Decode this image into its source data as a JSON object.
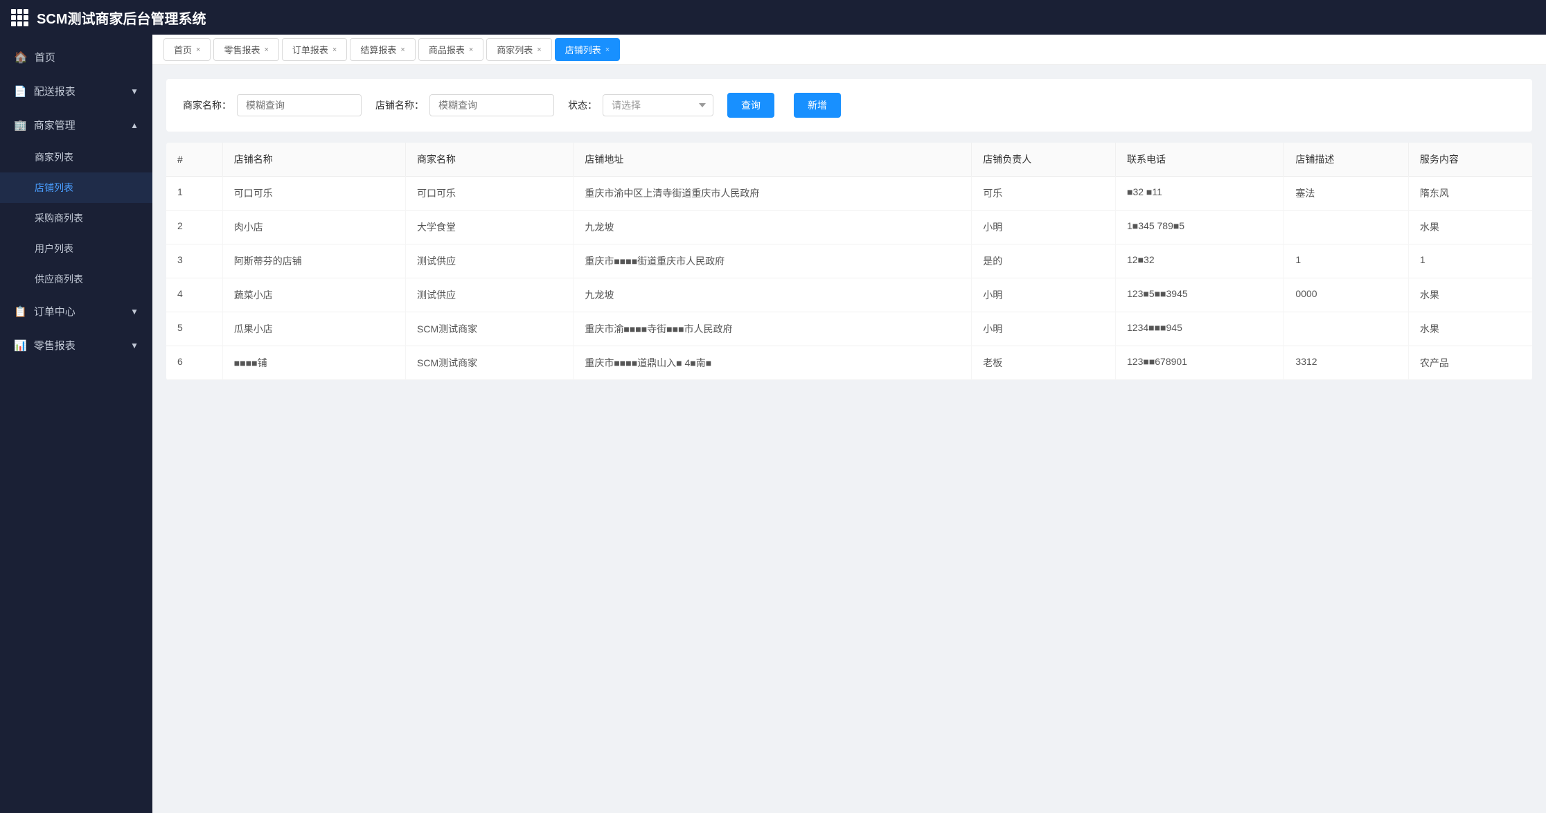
{
  "app": {
    "title": "SCM测试商家后台管理系统"
  },
  "header": {
    "title": "SCM测试商家后台管理系统"
  },
  "sidebar": {
    "items": [
      {
        "id": "home",
        "label": "首页",
        "icon": "🏠",
        "type": "item",
        "active": false
      },
      {
        "id": "delivery-report",
        "label": "配送报表",
        "icon": "📄",
        "type": "group",
        "expanded": false
      },
      {
        "id": "merchant-mgmt",
        "label": "商家管理",
        "icon": "🏢",
        "type": "group",
        "expanded": true
      },
      {
        "id": "merchant-list",
        "label": "商家列表",
        "type": "sub",
        "active": false
      },
      {
        "id": "store-list",
        "label": "店铺列表",
        "type": "sub",
        "active": true
      },
      {
        "id": "purchase-list",
        "label": "采购商列表",
        "type": "sub",
        "active": false
      },
      {
        "id": "user-list",
        "label": "用户列表",
        "type": "sub",
        "active": false
      },
      {
        "id": "supplier-list",
        "label": "供应商列表",
        "type": "sub",
        "active": false
      },
      {
        "id": "order-center",
        "label": "订单中心",
        "icon": "📋",
        "type": "group",
        "expanded": false
      },
      {
        "id": "retail-report",
        "label": "零售报表",
        "icon": "📊",
        "type": "group",
        "expanded": false
      }
    ]
  },
  "tabs": [
    {
      "label": "首页",
      "closable": true,
      "active": false
    },
    {
      "label": "零售报表",
      "closable": true,
      "active": false
    },
    {
      "label": "订单报表",
      "closable": true,
      "active": false
    },
    {
      "label": "结算报表",
      "closable": true,
      "active": false
    },
    {
      "label": "商品报表",
      "closable": true,
      "active": false
    },
    {
      "label": "商家列表",
      "closable": true,
      "active": false
    },
    {
      "label": "店铺列表",
      "closable": true,
      "active": true
    }
  ],
  "search": {
    "merchant_name_label": "商家名称：",
    "merchant_name_placeholder": "模糊查询",
    "store_name_label": "店铺名称：",
    "store_name_placeholder": "模糊查询",
    "status_label": "状态：",
    "status_placeholder": "请选择",
    "query_btn": "查询",
    "add_btn": "新增"
  },
  "table": {
    "columns": [
      "#",
      "店铺名称",
      "商家名称",
      "店铺地址",
      "店铺负责人",
      "联系电话",
      "店铺描述",
      "服务内容"
    ],
    "rows": [
      {
        "index": "1",
        "store_name": "可口可乐",
        "merchant_name": "可口可乐",
        "address": "重庆市渝中区上清寺街道重庆市人民政府",
        "manager": "可乐",
        "phone": "■32 ■11",
        "description": "塞法",
        "service": "隋东风"
      },
      {
        "index": "2",
        "store_name": "肉小店",
        "merchant_name": "大学食堂",
        "address": "九龙坡",
        "manager": "小明",
        "phone": "1■345 789■5",
        "description": "",
        "service": "水果"
      },
      {
        "index": "3",
        "store_name": "阿斯蒂芬的店铺",
        "merchant_name": "测试供应",
        "address": "重庆市■■■■街道重庆市人民政府",
        "manager": "是的",
        "phone": "12■32",
        "description": "1",
        "service": "1"
      },
      {
        "index": "4",
        "store_name": "蔬菜小店",
        "merchant_name": "测试供应",
        "address": "九龙坡",
        "manager": "小明",
        "phone": "123■5■■3945",
        "description": "0000",
        "service": "水果"
      },
      {
        "index": "5",
        "store_name": "瓜果小店",
        "merchant_name": "SCM测试商家",
        "address": "重庆市渝■■■■寺街■■■市人民政府",
        "manager": "小明",
        "phone": "1234■■■945",
        "description": "",
        "service": "水果"
      },
      {
        "index": "6",
        "store_name": "■■■■铺",
        "merchant_name": "SCM测试商家",
        "address": "重庆市■■■■道鼎山入■ 4■南■",
        "manager": "老板",
        "phone": "123■■678901",
        "description": "3312",
        "service": "农产品"
      }
    ]
  }
}
